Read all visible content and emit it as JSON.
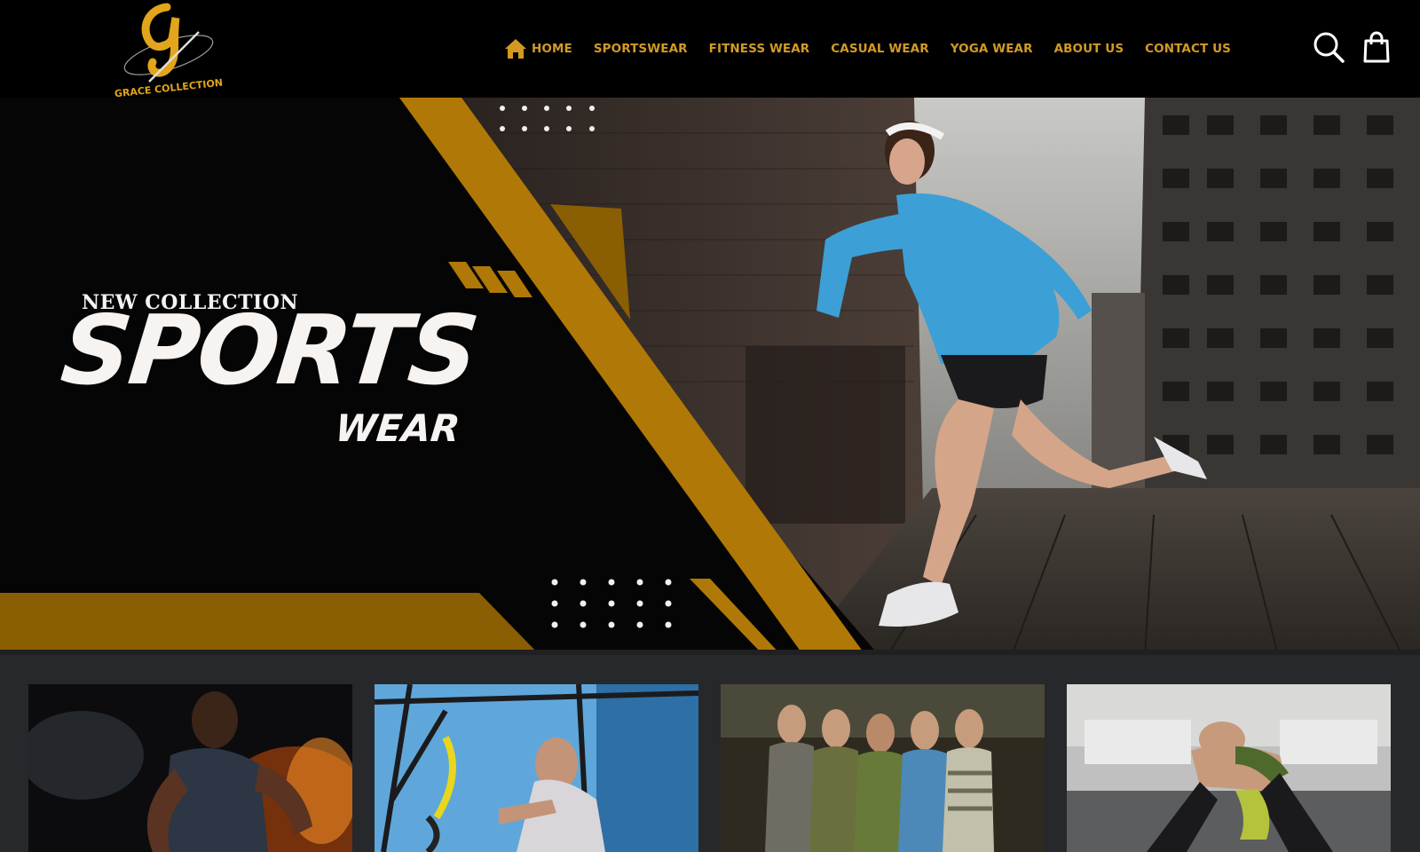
{
  "brand": {
    "name": "GRACE COLLECTION",
    "logo_letter": "G",
    "accent_color": "#d29a25"
  },
  "nav": {
    "items": [
      {
        "label": "HOME",
        "icon": "home-icon"
      },
      {
        "label": "SPORTSWEAR"
      },
      {
        "label": "FITNESS WEAR"
      },
      {
        "label": "CASUAL WEAR"
      },
      {
        "label": "YOGA WEAR"
      },
      {
        "label": "ABOUT US"
      },
      {
        "label": "CONTACT US"
      }
    ]
  },
  "header_icons": [
    "search-icon",
    "shopping-bag-icon"
  ],
  "hero": {
    "kicker": "NEW COLLECTION",
    "title": "SPORTS",
    "subtitle": "WEAR",
    "image": "woman-running-photo"
  },
  "categories": [
    {
      "image": "man-running-fire-photo"
    },
    {
      "image": "woman-trx-training-photo"
    },
    {
      "image": "group-casual-tshirts-photo"
    },
    {
      "image": "woman-yoga-rest-photo"
    }
  ]
}
